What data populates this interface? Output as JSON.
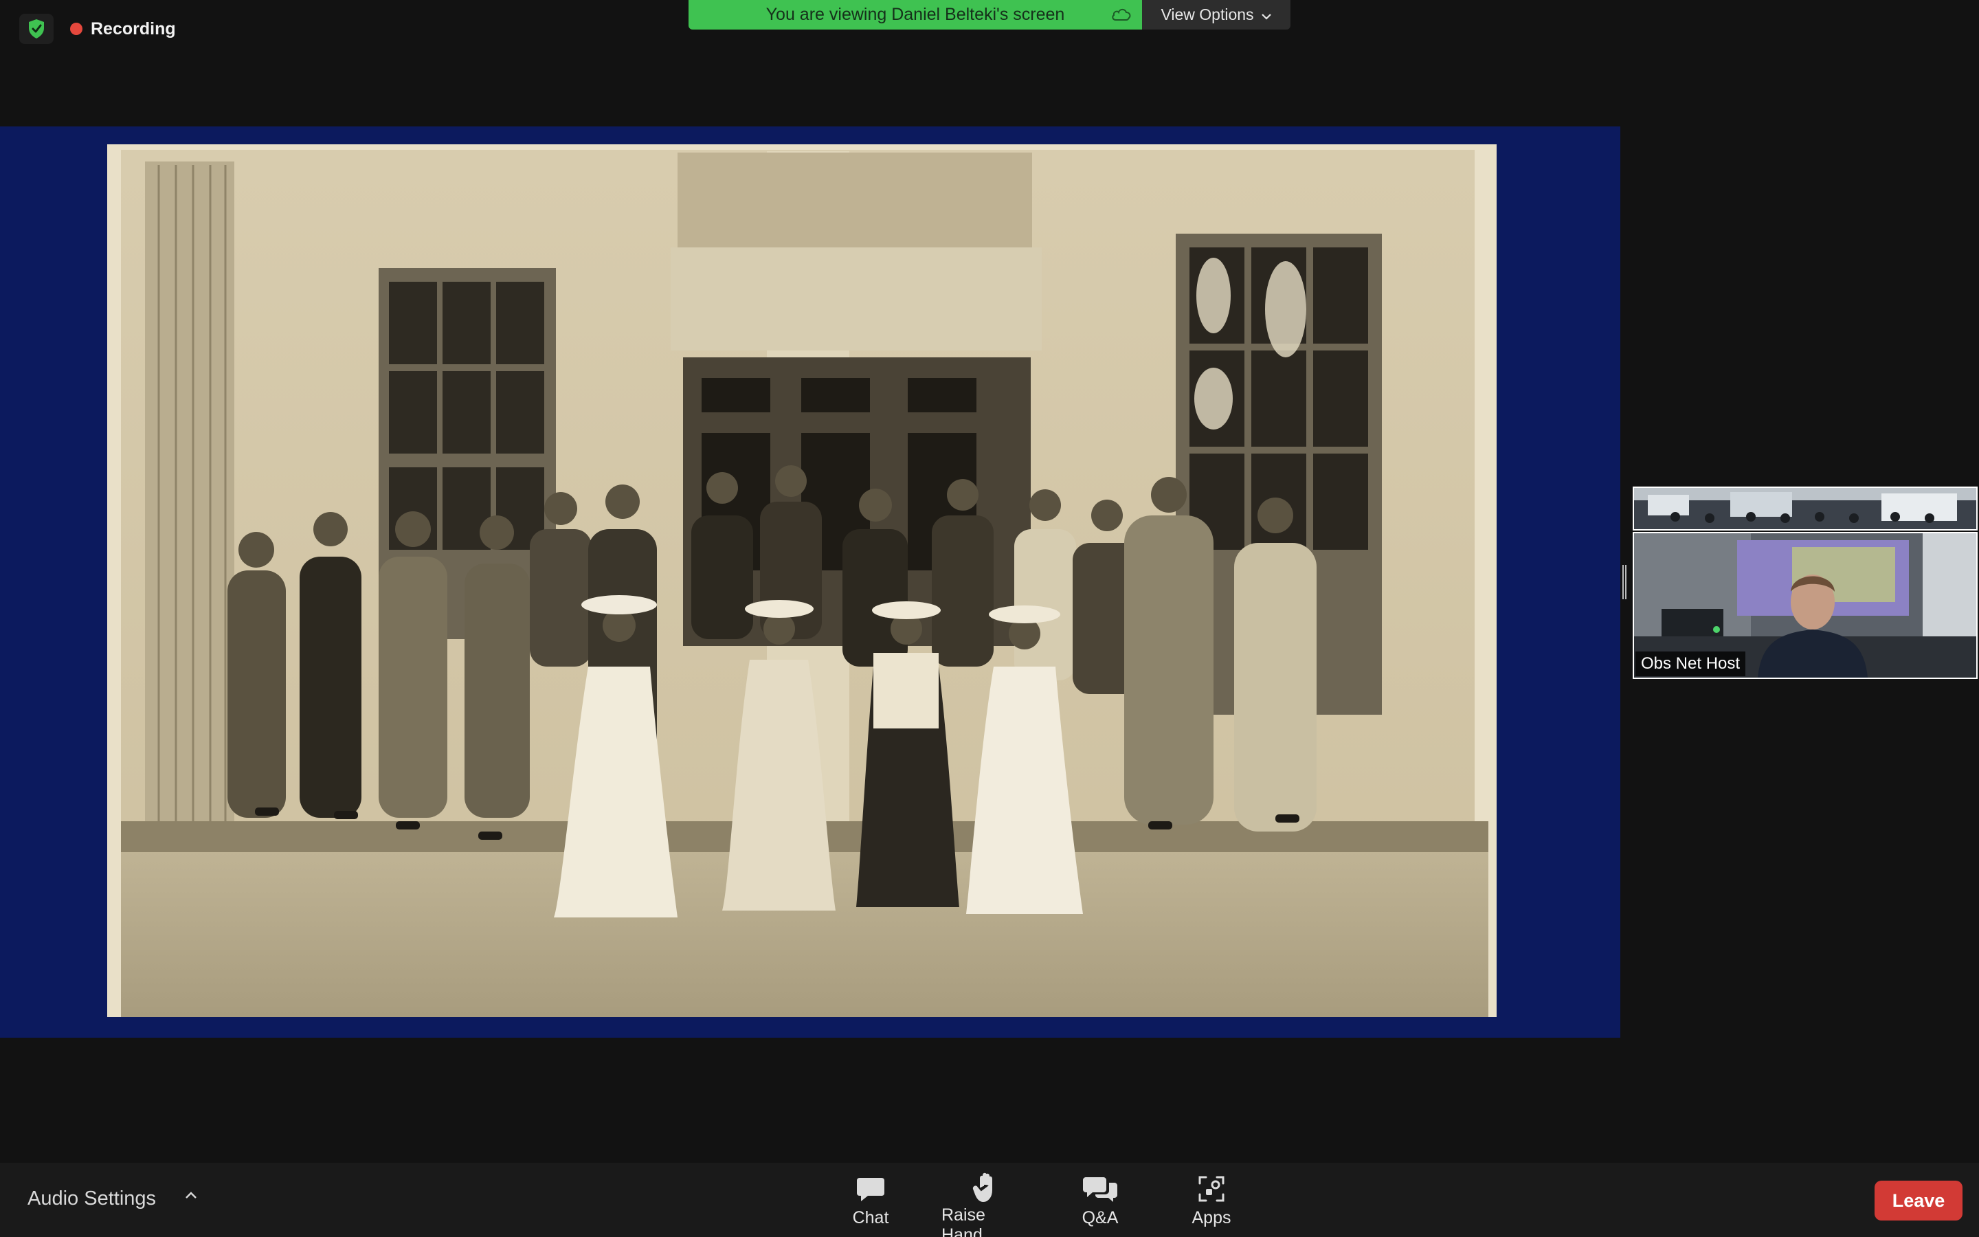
{
  "status": {
    "recording_label": "Recording"
  },
  "banner": {
    "viewing_text": "You are viewing Daniel Belteki's screen",
    "view_options_label": "View Options"
  },
  "participants": {
    "active_tile_name": "Obs Net Host"
  },
  "toolbar": {
    "audio_settings_label": "Audio Settings",
    "buttons": [
      {
        "label": "Chat",
        "icon": "chat-icon"
      },
      {
        "label": "Raise Hand",
        "icon": "hand-icon"
      },
      {
        "label": "Q&A",
        "icon": "qa-icon"
      },
      {
        "label": "Apps",
        "icon": "apps-icon"
      }
    ],
    "leave_label": "Leave"
  },
  "colors": {
    "banner_green": "#3fc251",
    "share_background": "#0c1a5e",
    "leave_red": "#d23a35",
    "recording_red": "#e5483d",
    "shield_green": "#3fc251"
  }
}
